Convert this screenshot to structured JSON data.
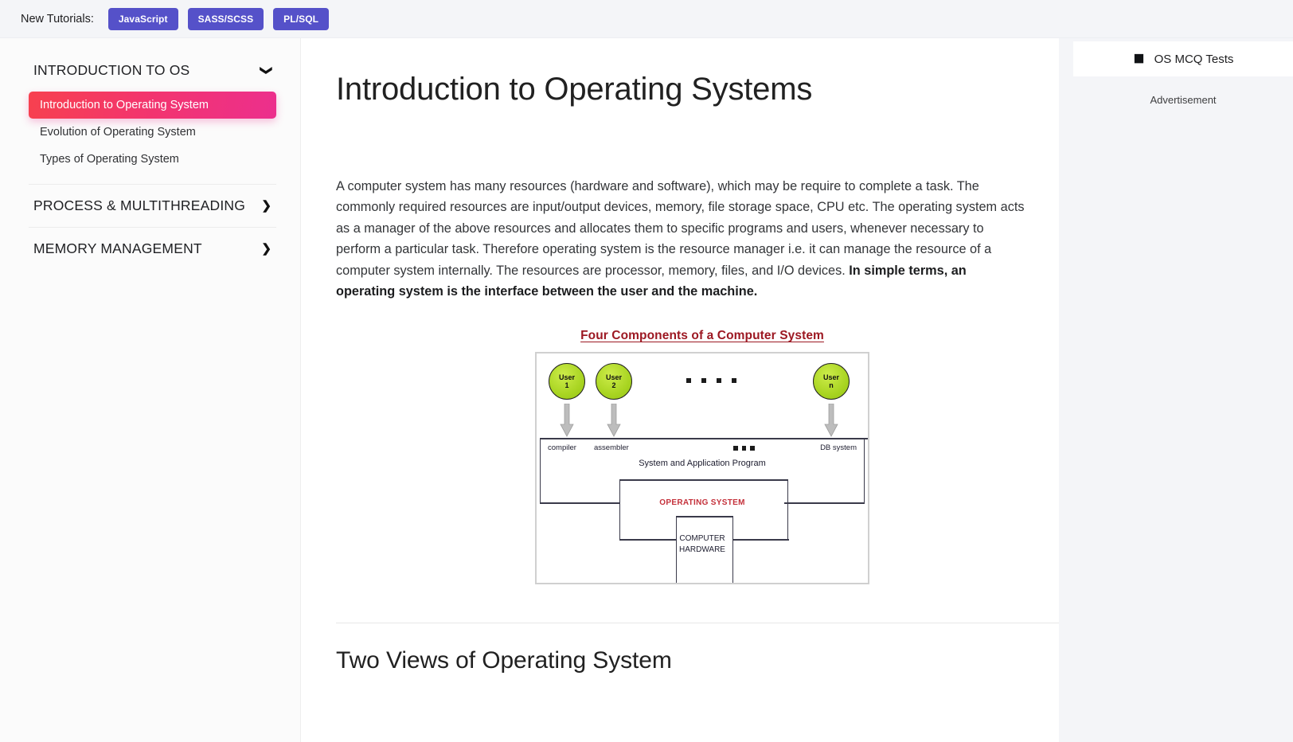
{
  "topbar": {
    "label": "New Tutorials:",
    "buttons": [
      {
        "label": "JavaScript"
      },
      {
        "label": "SASS/SCSS"
      },
      {
        "label": "PL/SQL"
      }
    ],
    "button_color": "#5551c9"
  },
  "sidebar": {
    "groups": [
      {
        "title": "INTRODUCTION TO OS",
        "chevron": "down-chevron-icon",
        "expanded": true,
        "items": [
          {
            "label": "Introduction to Operating System",
            "active": true
          },
          {
            "label": "Evolution of Operating System",
            "active": false
          },
          {
            "label": "Types of Operating System",
            "active": false
          }
        ]
      },
      {
        "title": "PROCESS & MULTITHREADING",
        "chevron": "right-chevron-icon",
        "expanded": false,
        "items": []
      },
      {
        "title": "MEMORY MANAGEMENT",
        "chevron": "right-chevron-icon",
        "expanded": false,
        "items": []
      }
    ],
    "active_gradient_from": "#f7414f",
    "active_gradient_to": "#ec2f8d"
  },
  "main": {
    "page_title": "Introduction to Operating Systems",
    "paragraph_plain": "A computer system has many resources (hardware and software), which may be require to complete a task. The commonly required resources are input/output devices, memory, file storage space, CPU etc. The operating system acts as a manager of the above resources and allocates them to specific programs and users, whenever necessary to perform a particular task. Therefore operating system is the resource manager i.e. it can manage the resource of a computer system internally. The resources are processor, memory, files, and I/O devices. ",
    "paragraph_bold": "In simple terms, an operating system is the interface between the user and the machine.",
    "sub_title": "Two Views of Operating System"
  },
  "figure": {
    "title": "Four Components of a Computer System",
    "title_color": "#9c1822",
    "users": [
      {
        "line1": "User",
        "line2": "1"
      },
      {
        "line1": "User",
        "line2": "2"
      },
      {
        "line1": "User",
        "line2": "n"
      }
    ],
    "user_dots_count": 4,
    "program_dots_count": 3,
    "labels": {
      "compiler": "compiler",
      "assembler": "assembler",
      "db_system": "DB system",
      "system_and_application_program": "System and Application Program",
      "operating_system": "OPERATING SYSTEM",
      "computer_hardware_line1": "COMPUTER",
      "computer_hardware_line2": "HARDWARE"
    },
    "os_text_color": "#c4303a",
    "user_circle_color": "#a8d421"
  },
  "rail": {
    "mcq_icon": "checkbox-check-icon",
    "mcq_label": "OS MCQ Tests",
    "ad_label": "Advertisement"
  }
}
